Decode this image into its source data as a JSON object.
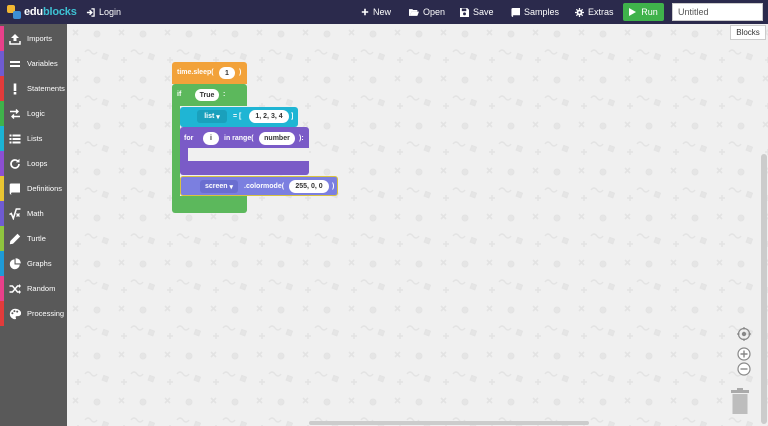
{
  "navbar": {
    "logo_edu": "edu",
    "logo_blocks": "blocks",
    "login": "Login",
    "new": "New",
    "open": "Open",
    "save": "Save",
    "samples": "Samples",
    "extras": "Extras",
    "run": "Run",
    "title_placeholder": "Untitled",
    "colors": {
      "background": "#2b2a4c",
      "run": "#3fb24b"
    }
  },
  "sidebar": {
    "items": [
      {
        "label": "Imports",
        "color": "#e8408a"
      },
      {
        "label": "Variables",
        "color": "#6f5bd1"
      },
      {
        "label": "Statements",
        "color": "#e23b3b"
      },
      {
        "label": "Logic",
        "color": "#3fb24b"
      },
      {
        "label": "Lists",
        "color": "#1bb3d4"
      },
      {
        "label": "Loops",
        "color": "#8c4fd1"
      },
      {
        "label": "Definitions",
        "color": "#e9c532"
      },
      {
        "label": "Math",
        "color": "#6f5bd1"
      },
      {
        "label": "Turtle",
        "color": "#8fc43e"
      },
      {
        "label": "Graphs",
        "color": "#1e9ad6"
      },
      {
        "label": "Random",
        "color": "#e8408a"
      },
      {
        "label": "Processing",
        "color": "#e23b3b"
      }
    ]
  },
  "workspace": {
    "blocks_toggle": "Blocks",
    "program": {
      "sleep": {
        "label": "time.sleep(",
        "arg": "1",
        "close": ")",
        "color": "#f2a23a"
      },
      "if": {
        "label": "if",
        "cond": "True",
        "colon": ":",
        "color": "#5cb85c"
      },
      "list": {
        "var": "list",
        "assign": "= [",
        "value": "1, 2, 3, 4",
        "close": "]",
        "color": "#1fb5d4"
      },
      "for": {
        "label": "for",
        "var": "i",
        "in": "in range(",
        "arg": "number",
        "close": "):",
        "color": "#7a5bc7"
      },
      "colormode": {
        "var": "screen",
        "method": ".colormode(",
        "arg": "255, 0, 0",
        "close": ")",
        "color": "#7b7fe0"
      }
    }
  }
}
